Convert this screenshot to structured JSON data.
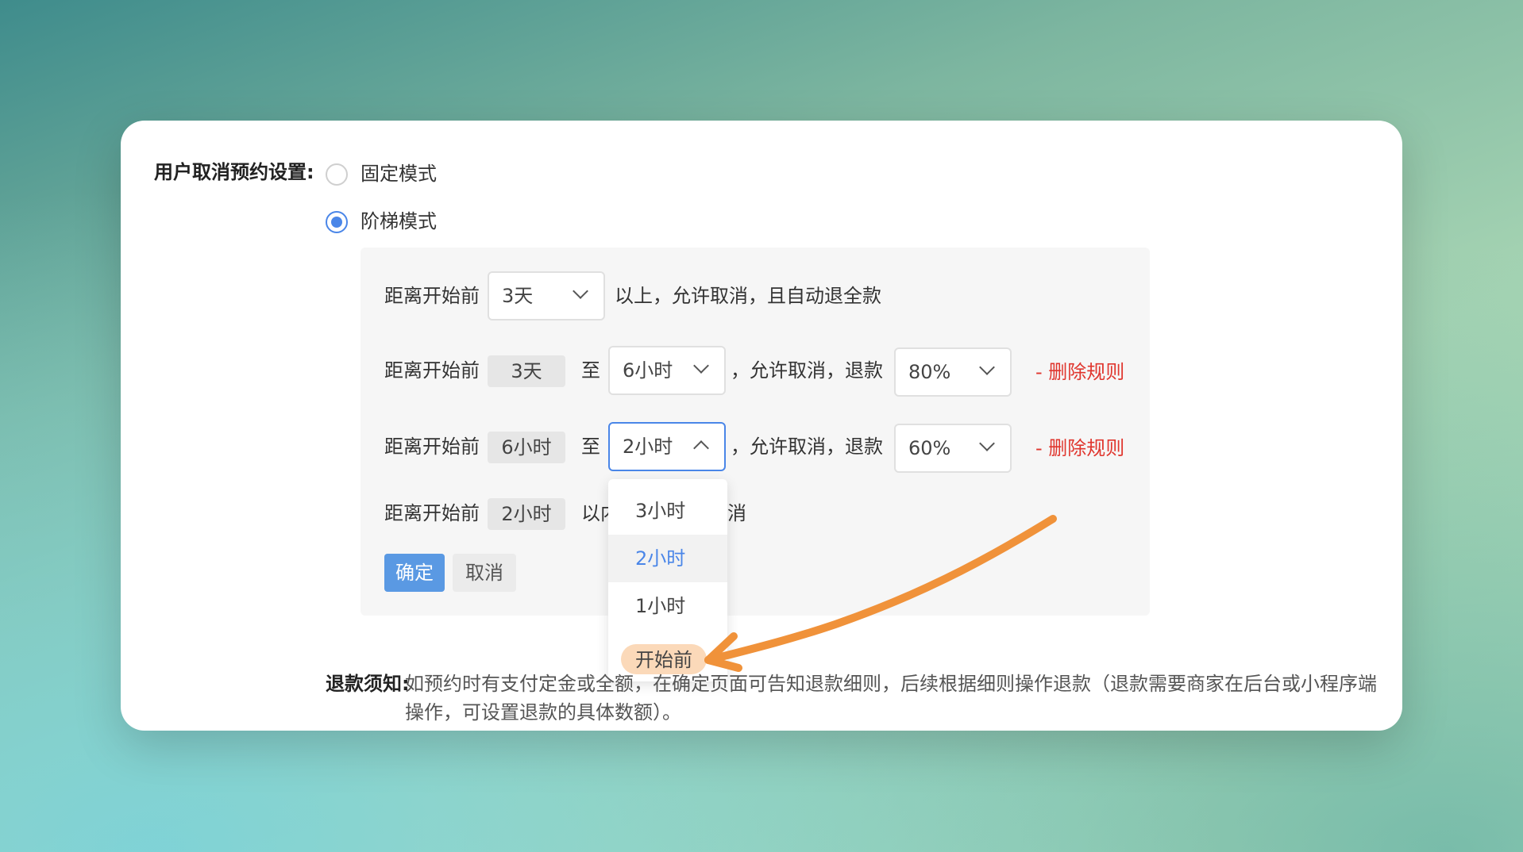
{
  "section_label": "用户取消预约设置:",
  "modes": {
    "fixed": "固定模式",
    "tiered": "阶梯模式",
    "selected": "tiered"
  },
  "rules": {
    "rule1": {
      "prefix": "距离开始前",
      "select_value": "3天",
      "suffix": "以上，允许取消，且自动退全款"
    },
    "rule2": {
      "prefix": "距离开始前",
      "from_tag": "3天",
      "to_word": "至",
      "to_select": "6小时",
      "mid": "，允许取消，退款",
      "refund_select": "80%",
      "delete": "- 删除规则"
    },
    "rule3": {
      "prefix": "距离开始前",
      "from_tag": "6小时",
      "to_word": "至",
      "to_select": "2小时",
      "mid": "，允许取消，退款",
      "refund_select": "60%",
      "delete": "- 删除规则"
    },
    "rule4": {
      "prefix": "距离开始前",
      "from_tag": "2小时",
      "suffix_visible": "以内",
      "suffix_end": "消"
    }
  },
  "buttons": {
    "confirm": "确定",
    "cancel": "取消"
  },
  "dropdown": {
    "options": [
      "3小时",
      "2小时",
      "1小时",
      "开始前"
    ],
    "selected": "2小时",
    "highlighted": "开始前"
  },
  "notice": {
    "label": "退款须知:",
    "text": "如预约时有支付定金或全额，在确定页面可告知退款细则，后续根据细则操作退款（退款需要商家在后台或小程序端操作，可设置退款的具体数额）。"
  },
  "colors": {
    "accent": "#4a86e8",
    "danger": "#e0362e",
    "annotation_arrow": "#f0923a"
  }
}
